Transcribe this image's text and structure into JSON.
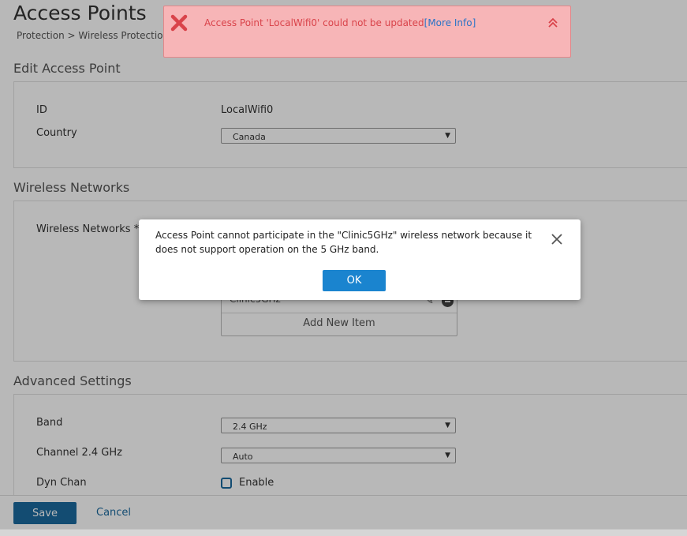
{
  "page": {
    "title": "Access Points",
    "breadcrumb": "Protection > Wireless Protection > Access Points"
  },
  "edit_section": {
    "title": "Edit Access Point",
    "id_label": "ID",
    "id_value": "LocalWifi0",
    "country_label": "Country",
    "country_value": "Canada"
  },
  "wireless_section": {
    "title": "Wireless Networks",
    "networks_label": "Wireless Networks *",
    "items": [
      "Clinic5GHz"
    ],
    "add_new_label": "Add New Item"
  },
  "advanced_section": {
    "title": "Advanced Settings",
    "band_label": "Band",
    "band_value": "2.4 GHz",
    "channel_label": "Channel 2.4 GHz",
    "channel_value": "Auto",
    "dynchan_label": "Dyn Chan",
    "dynchan_checkbox_label": "Enable",
    "dynchan_checked": false
  },
  "footer": {
    "save_label": "Save",
    "cancel_label": "Cancel"
  },
  "toast": {
    "message": "Access Point 'LocalWifi0' could not be updated",
    "link_label": "[More Info]",
    "error_icon": "error-x-icon",
    "collapse_icon": "double-chevron-up-icon"
  },
  "dialog": {
    "message": "Access Point cannot participate in the \"Clinic5GHz\" wireless network because it does not support operation on the 5 GHz band.",
    "ok_label": "OK",
    "close_icon": "close-icon"
  },
  "colors": {
    "primary": "#1b6a9f",
    "ok_button": "#1a84cf",
    "error_text": "#d9434a",
    "error_bg": "#f7b5b7"
  }
}
